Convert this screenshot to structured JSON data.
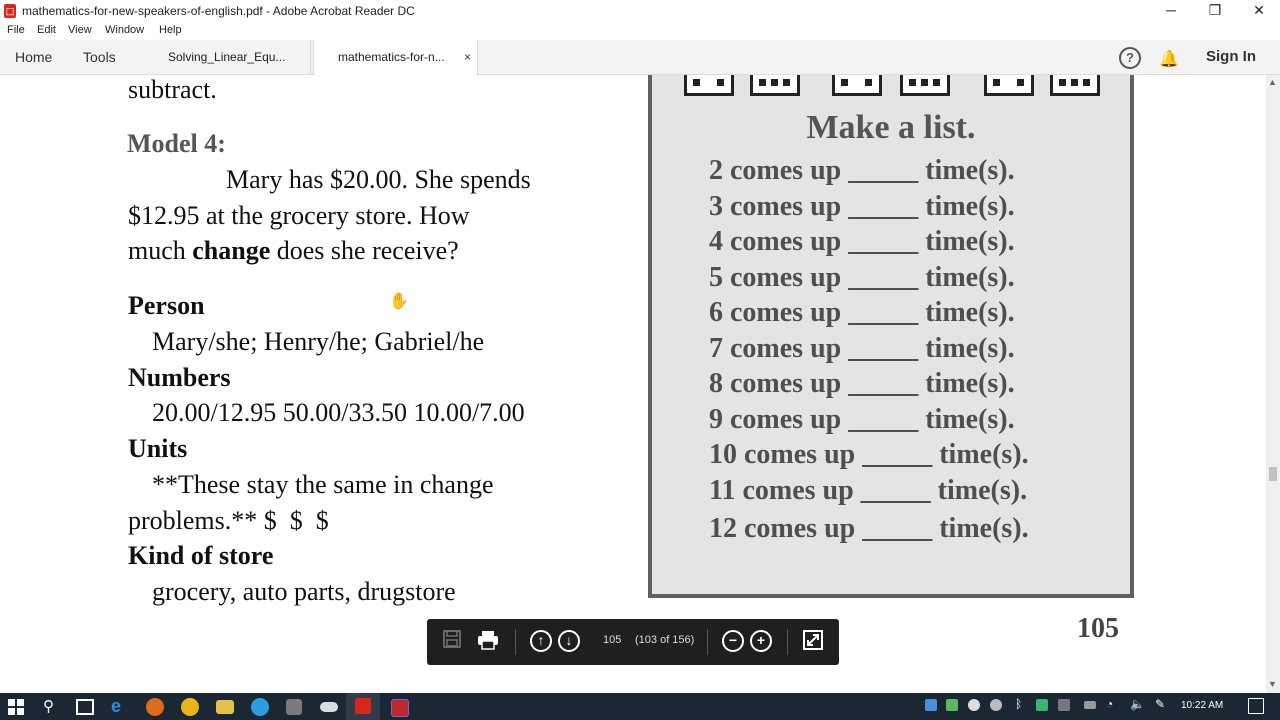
{
  "window": {
    "title": "mathematics-for-new-speakers-of-english.pdf - Adobe Acrobat Reader DC",
    "minimize": "─",
    "restore": "❐",
    "close": "✕"
  },
  "menu": [
    "File",
    "Edit",
    "View",
    "Window",
    "Help"
  ],
  "tabs": {
    "home": "Home",
    "tools": "Tools",
    "doc1": "Solving_Linear_Equ...",
    "doc2": "mathematics-for-n...",
    "close": "×",
    "sign_in": "Sign In"
  },
  "page_left": {
    "subtract": "subtract.",
    "model_heading": "Model 4:",
    "problem_line1": "Mary has $20.00. She spends",
    "problem_line2": "$12.95 at the grocery store. How",
    "problem_line3_pre": "much ",
    "problem_line3_bold": "change",
    "problem_line3_post": " does she receive?",
    "person_heading": "Person",
    "person_value": "Mary/she; Henry/he; Gabriel/he",
    "numbers_heading": "Numbers",
    "numbers_value": "20.00/12.95 50.00/33.50 10.00/7.00",
    "units_heading": "Units",
    "units_line1": "**These stay the same in change",
    "units_line2": "problems.** $  $  $",
    "store_heading": "Kind of store",
    "store_value": "grocery, auto parts, drugstore"
  },
  "page_right": {
    "title": "Make a list.",
    "rows": [
      "2 comes up _____ time(s).",
      "3 comes up _____ time(s).",
      "4 comes up _____ time(s).",
      "5 comes up _____ time(s).",
      "6 comes up _____ time(s).",
      "7 comes up _____ time(s).",
      "8 comes up _____ time(s).",
      "9 comes up _____ time(s).",
      "10 comes up _____ time(s).",
      "11 comes up _____ time(s).",
      "12 comes up _____ time(s)."
    ]
  },
  "page_number": "105",
  "toolbar": {
    "page_input": "105",
    "page_of": "(103 of 156)"
  },
  "taskbar": {
    "time": "10:22 AM"
  },
  "colors": {
    "acrobat_red": "#d9261c",
    "taskbar": "#1b2733",
    "float_toolbar": "#1f1f1f"
  }
}
